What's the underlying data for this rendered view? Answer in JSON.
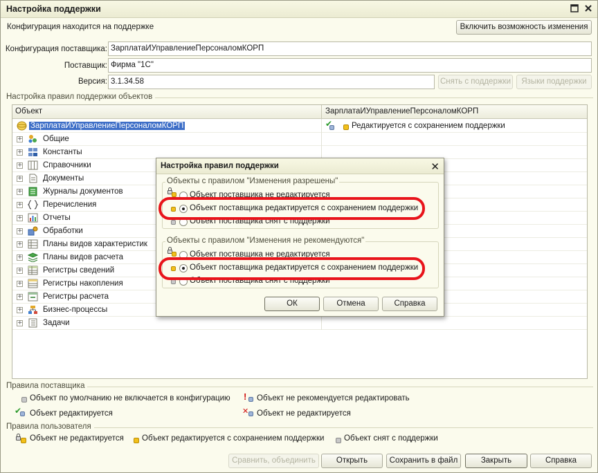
{
  "window": {
    "title": "Настройка поддержки",
    "status_text": "Конфигурация находится на поддержке",
    "enable_changes_button": "Включить возможность изменения"
  },
  "vendor": {
    "config_label": "Конфигурация поставщика:",
    "config_value": "ЗарплатаИУправлениеПерсоналомКОРП",
    "vendor_label": "Поставщик:",
    "vendor_value": "Фирма \"1С\"",
    "version_label": "Версия:",
    "version_value": "3.1.34.58",
    "remove_support_button": "Снять с поддержки",
    "languages_button": "Языки поддержки"
  },
  "rules_group_title": "Настройка правил поддержки объектов",
  "tree": {
    "col_object": "Объект",
    "col_config": "ЗарплатаИУправлениеПерсоналомКОРП",
    "root": {
      "label": "ЗарплатаИУправлениеПерсоналомКОРП",
      "rule": "Редактируется с сохранением поддержки"
    },
    "items": [
      {
        "label": "Общие",
        "icon": "common-icon"
      },
      {
        "label": "Константы",
        "icon": "constants-icon"
      },
      {
        "label": "Справочники",
        "icon": "catalogs-icon"
      },
      {
        "label": "Документы",
        "icon": "documents-icon"
      },
      {
        "label": "Журналы документов",
        "icon": "journals-icon"
      },
      {
        "label": "Перечисления",
        "icon": "enums-icon"
      },
      {
        "label": "Отчеты",
        "icon": "reports-icon"
      },
      {
        "label": "Обработки",
        "icon": "dataprocessors-icon"
      },
      {
        "label": "Планы видов характеристик",
        "icon": "chart-of-characteristics-icon"
      },
      {
        "label": "Планы видов расчета",
        "icon": "chart-of-calculation-icon"
      },
      {
        "label": "Регистры сведений",
        "icon": "info-registers-icon"
      },
      {
        "label": "Регистры накопления",
        "icon": "accumulation-registers-icon"
      },
      {
        "label": "Регистры расчета",
        "icon": "calculation-registers-icon"
      },
      {
        "label": "Бизнес-процессы",
        "icon": "business-processes-icon"
      },
      {
        "label": "Задачи",
        "icon": "tasks-icon"
      }
    ]
  },
  "dialog": {
    "title": "Настройка правил поддержки",
    "group1": {
      "legend": "Объекты с правилом \"Изменения разрешены\"",
      "options": [
        "Объект поставщика не редактируется",
        "Объект поставщика редактируется с сохранением поддержки",
        "Объект поставщика снят с поддержки"
      ],
      "selected": 1
    },
    "group2": {
      "legend": "Объекты с правилом \"Изменения не рекомендуются\"",
      "options": [
        "Объект поставщика не редактируется",
        "Объект поставщика редактируется с сохранением поддержки",
        "Объект поставщика снят с поддержки"
      ],
      "selected": 1
    },
    "ok_button": "ОК",
    "cancel_button": "Отмена",
    "help_button": "Справка"
  },
  "vendor_rules": {
    "title": "Правила поставщика",
    "default_not_included": "Объект по умолчанию не включается в конфигурацию",
    "not_recommended": "Объект не рекомендуется редактировать",
    "editable": "Объект редактируется",
    "not_editable": "Объект не редактируется"
  },
  "user_rules": {
    "title": "Правила пользователя",
    "not_edited": "Объект не редактируется",
    "edited_keep_support": "Объект редактируется с сохранением поддержки",
    "removed_from_support": "Объект снят с поддержки"
  },
  "footer": {
    "compare_merge_button": "Сравнить, объединить",
    "open_button": "Открыть",
    "save_to_file_button": "Сохранить в файл",
    "close_button": "Закрыть",
    "help_button": "Справка"
  },
  "colors": {
    "window_bg": "#fbfbed",
    "selection": "#3d6ec7",
    "highlight_ring": "#e8141b",
    "support_yellow": "#f2c01b"
  }
}
